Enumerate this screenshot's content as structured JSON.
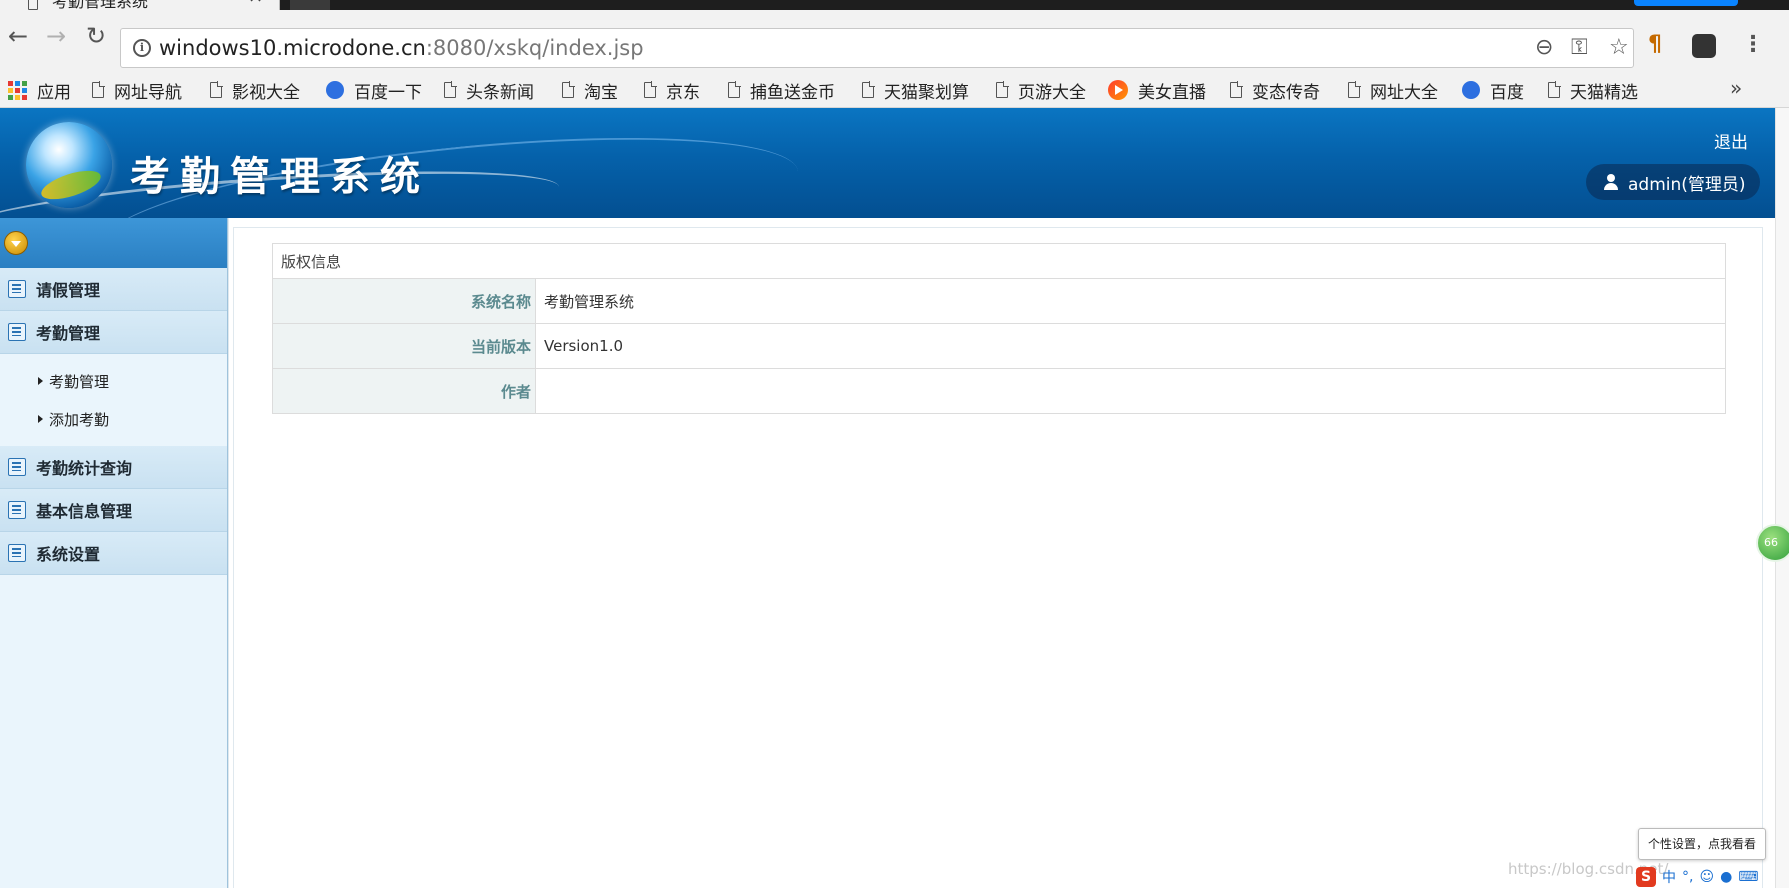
{
  "browser": {
    "tab_title": "考勤管理系统",
    "tab_close": "×",
    "url_host": "windows10.microdone.cn",
    "url_rest": ":8080/xskq/index.jsp",
    "bookmarks": [
      "应用",
      "网址导航",
      "影视大全",
      "百度一下",
      "头条新闻",
      "淘宝",
      "京东",
      "捕鱼送金币",
      "天猫聚划算",
      "页游大全",
      "美女直播",
      "变态传奇",
      "网址大全",
      "百度",
      "天猫精选"
    ],
    "bookmarks_more": "»"
  },
  "header": {
    "title": "考勤管理系统",
    "logout": "退出",
    "user": "admin(管理员)"
  },
  "sidebar": {
    "groups": [
      {
        "label": "请假管理"
      },
      {
        "label": "考勤管理",
        "items": [
          "考勤管理",
          "添加考勤"
        ]
      },
      {
        "label": "考勤统计查询"
      },
      {
        "label": "基本信息管理"
      },
      {
        "label": "系统设置"
      }
    ]
  },
  "main": {
    "caption": "版权信息",
    "rows": [
      {
        "label": "系统名称",
        "value": "考勤管理系统"
      },
      {
        "label": "当前版本",
        "value": "Version1.0"
      },
      {
        "label": "作者",
        "value": ""
      }
    ]
  },
  "overlay": {
    "float_ball": "66",
    "tooltip": "个性设置，点我看看",
    "watermark": "https://blog.csdn.net/",
    "ime_logo": "S",
    "ime_mode": "中"
  },
  "colors": {
    "header_blue": "#0561aa",
    "sidebar_bg": "#eaf5fc",
    "label_color": "#5b8a8f"
  }
}
